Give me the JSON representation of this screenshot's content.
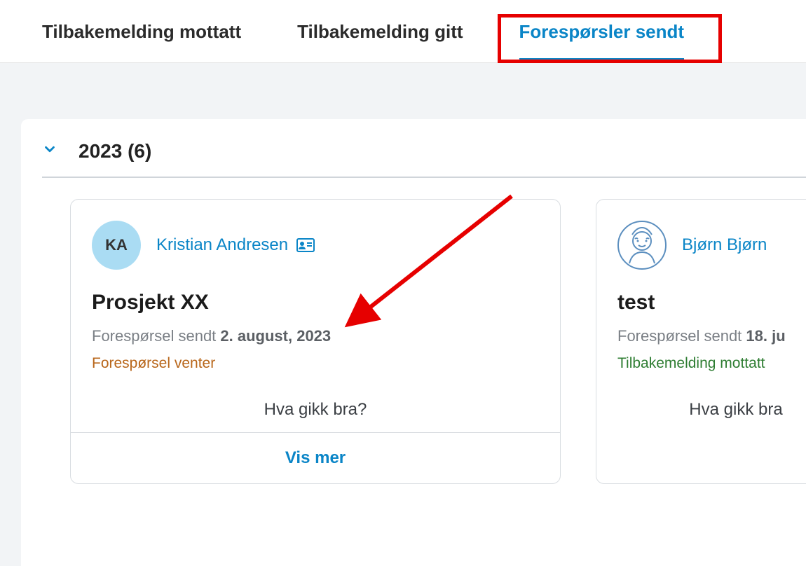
{
  "tabs": {
    "received": "Tilbakemelding mottatt",
    "given": "Tilbakemelding gitt",
    "sent": "Forespørsler sendt"
  },
  "section": {
    "title": "2023 (6)"
  },
  "cards": [
    {
      "avatar_initials": "KA",
      "person_name": "Kristian Andresen",
      "title": "Prosjekt XX",
      "sent_prefix": "Forespørsel sendt ",
      "sent_date": "2. august, 2023",
      "status": "Forespørsel venter",
      "question": "Hva gikk bra?",
      "show_more": "Vis mer"
    },
    {
      "person_name": "Bjørn Bjørn",
      "title": "test",
      "sent_prefix": "Forespørsel sendt ",
      "sent_date": "18. ju",
      "status": "Tilbakemelding mottatt",
      "question": "Hva gikk bra"
    }
  ]
}
